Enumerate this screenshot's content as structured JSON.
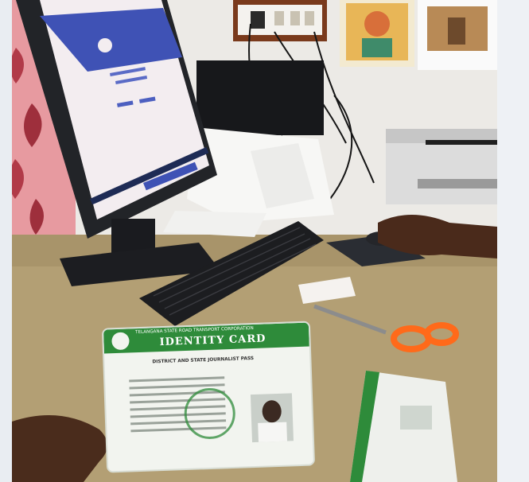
{
  "photo": {
    "subject": "office-desk",
    "colors": {
      "wall": "#eceae6",
      "curtain": "#e79aa0",
      "desk": "#b39f74",
      "monitor_frame": "#222428",
      "screen_header": "#3f52b5",
      "screen_body": "#f3edf0",
      "keyboard": "#1c1d20",
      "scissors": "#ff6a1a",
      "card_green": "#2e8b3a",
      "printer": "#dcdcdc"
    }
  },
  "id_card": {
    "org_line": "TELANGANA STATE ROAD TRANSPORT CORPORATION",
    "title": "IDENTITY CARD",
    "subtitle": "DISTRICT AND STATE JOURNALIST PASS"
  }
}
